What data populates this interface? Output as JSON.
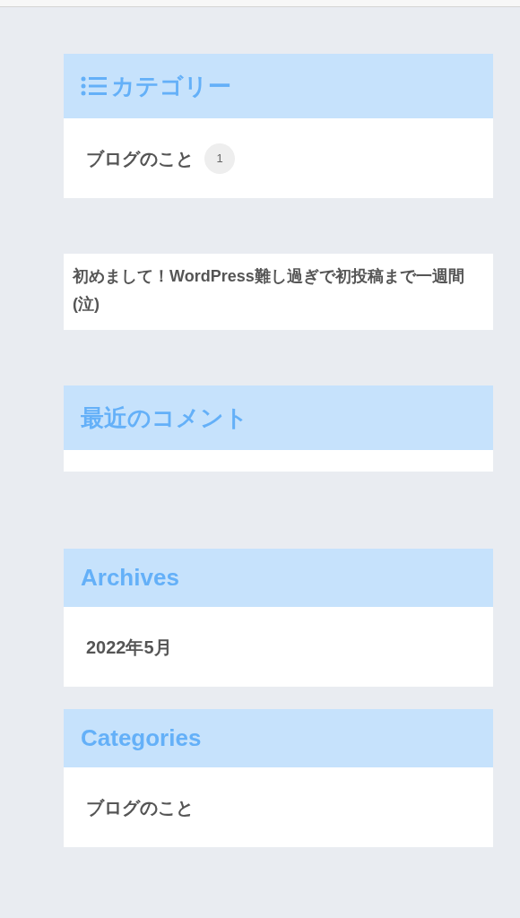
{
  "widgets": [
    {
      "kind": "category_list",
      "title": "カテゴリー",
      "items": [
        {
          "label": "ブログのこと",
          "count": "1"
        }
      ]
    },
    {
      "kind": "post_list",
      "items": [
        {
          "label": "初めまして！WordPress難し過ぎで初投稿まで一週間(泣)"
        }
      ]
    },
    {
      "kind": "comments",
      "title": "最近のコメント"
    },
    {
      "kind": "link_list",
      "title": "Archives",
      "items": [
        {
          "label": "2022年5月"
        }
      ]
    },
    {
      "kind": "link_list",
      "title": "Categories",
      "items": [
        {
          "label": "ブログのこと"
        }
      ]
    }
  ]
}
